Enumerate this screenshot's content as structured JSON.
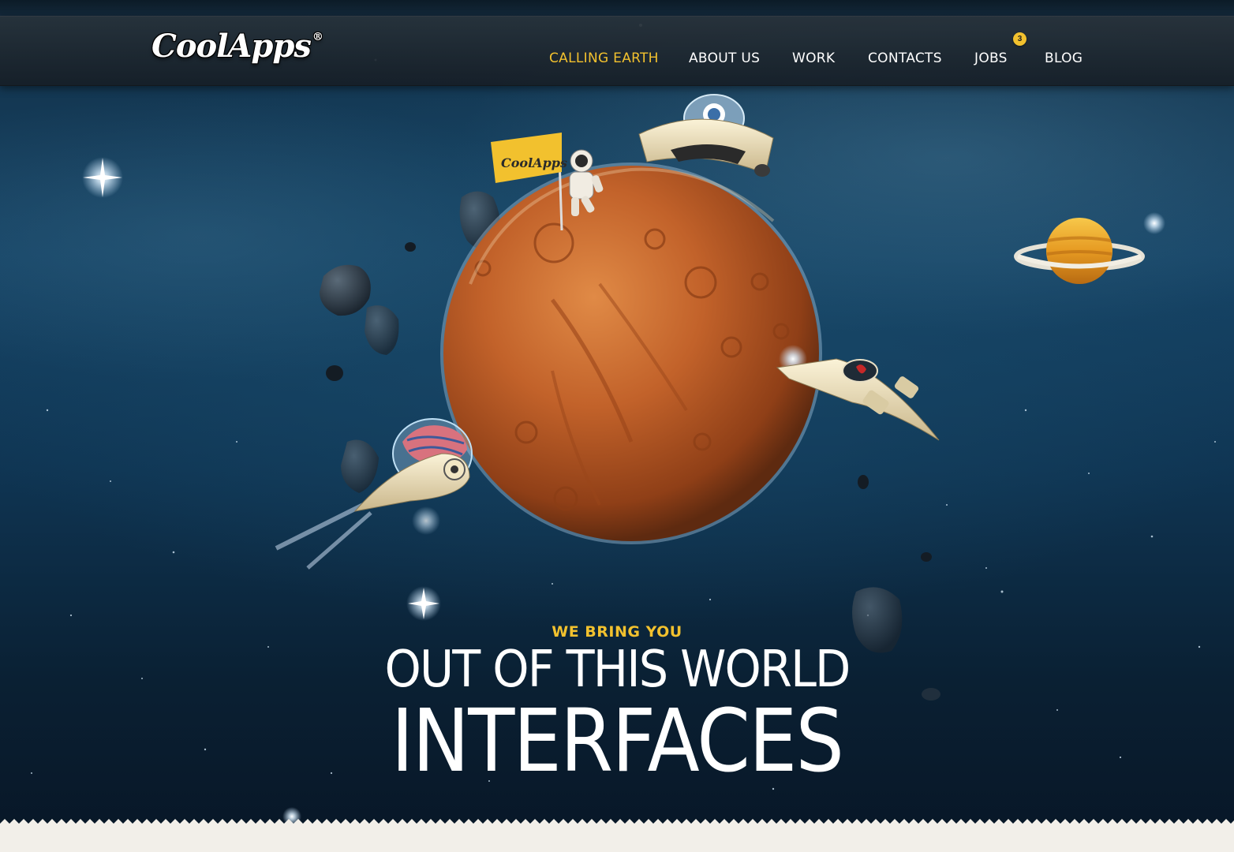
{
  "brand": {
    "logo_text": "CoolApps",
    "registered_mark": "®",
    "flag_text": "CoolApps"
  },
  "nav": {
    "items": [
      {
        "label": "CALLING EARTH",
        "active": true
      },
      {
        "label": "ABOUT US",
        "active": false
      },
      {
        "label": "WORK",
        "active": false
      },
      {
        "label": "CONTACTS",
        "active": false
      },
      {
        "label": "JOBS",
        "active": false
      },
      {
        "label": "BLOG",
        "active": false
      }
    ],
    "jobs_badge": "3"
  },
  "hero": {
    "tagline": "WE BRING YOU",
    "headline_line1": "OUT OF THIS WORLD",
    "headline_line2": "INTERFACES"
  },
  "colors": {
    "accent": "#f2c12e",
    "nav_text": "#ffffff",
    "planet": "#c2622a",
    "bottom_band": "#f2efe9"
  },
  "illustration": {
    "icons": [
      "planet-icon",
      "astronaut-icon",
      "flag-icon",
      "ufo-icon",
      "rocket-ship-icon",
      "brain-ship-icon",
      "saturn-icon",
      "asteroid-icon",
      "star-icon"
    ]
  }
}
